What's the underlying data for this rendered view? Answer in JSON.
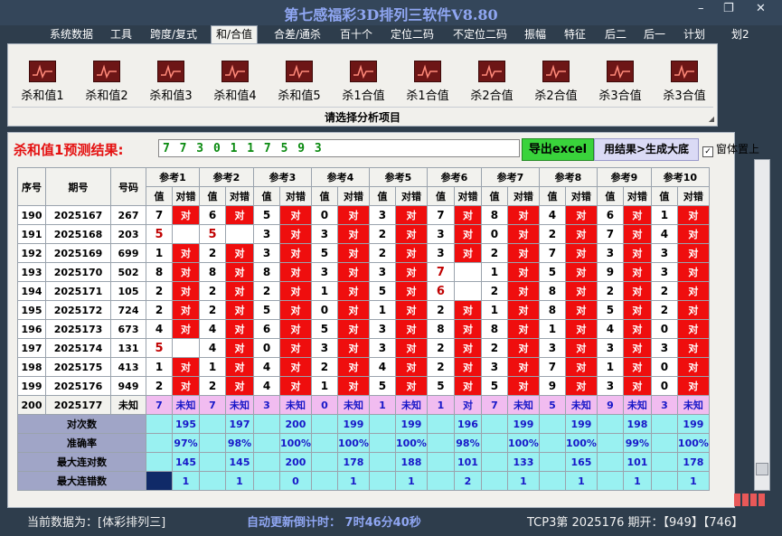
{
  "app": {
    "title": "第七感福彩3D排列三软件V8.80"
  },
  "menu": [
    "系统数据",
    "工具",
    "跨度/复式",
    "和/合值",
    "合差/通杀",
    "百十个",
    "定位二码",
    "不定位二码",
    "振幅",
    "特征",
    "后二",
    "后一",
    "计划",
    "划2"
  ],
  "menu_active_index": 3,
  "ribbon": {
    "buttons": [
      "杀和值1",
      "杀和值2",
      "杀和值3",
      "杀和值4",
      "杀和值5",
      "杀1合值",
      "杀1合值",
      "杀2合值",
      "杀2合值",
      "杀3合值",
      "杀3合值"
    ],
    "icon_name": "chart-icon",
    "caption": "请选择分析项目"
  },
  "prediction": {
    "label": "杀和值1预测结果:",
    "value": "7 7 3 0 1 1 7 5 9 3",
    "export_button": "导出excel",
    "result_button": "用结果>生成大底",
    "topmost_label": "窗体置上",
    "topmost_checked": true
  },
  "table": {
    "headers": [
      "序号",
      "期号",
      "号码"
    ],
    "refs": [
      "参考1",
      "参考2",
      "参考3",
      "参考4",
      "参考5",
      "参考6",
      "参考7",
      "参考8",
      "参考9",
      "参考10"
    ],
    "sub_headers": [
      "值",
      "对错"
    ],
    "hit_text": "对",
    "rows": [
      {
        "idx": "190",
        "period": "2025167",
        "code": "267",
        "vals": [
          "7",
          "6",
          "5",
          "0",
          "3",
          "7",
          "8",
          "4",
          "6",
          "1"
        ],
        "hits": [
          1,
          1,
          1,
          1,
          1,
          1,
          1,
          1,
          1,
          1
        ]
      },
      {
        "idx": "191",
        "period": "2025168",
        "code": "203",
        "vals": [
          "5",
          "5",
          "3",
          "3",
          "2",
          "3",
          "0",
          "2",
          "7",
          "4"
        ],
        "hits": [
          0,
          0,
          1,
          1,
          1,
          1,
          1,
          1,
          1,
          1
        ]
      },
      {
        "idx": "192",
        "period": "2025169",
        "code": "699",
        "vals": [
          "1",
          "2",
          "3",
          "5",
          "2",
          "3",
          "2",
          "7",
          "3",
          "3"
        ],
        "hits": [
          1,
          1,
          1,
          1,
          1,
          1,
          1,
          1,
          1,
          1
        ]
      },
      {
        "idx": "193",
        "period": "2025170",
        "code": "502",
        "vals": [
          "8",
          "8",
          "8",
          "3",
          "3",
          "7",
          "1",
          "5",
          "9",
          "3"
        ],
        "hits": [
          1,
          1,
          1,
          1,
          1,
          0,
          1,
          1,
          1,
          1
        ]
      },
      {
        "idx": "194",
        "period": "2025171",
        "code": "105",
        "vals": [
          "2",
          "2",
          "2",
          "1",
          "5",
          "6",
          "2",
          "8",
          "2",
          "2"
        ],
        "hits": [
          1,
          1,
          1,
          1,
          1,
          0,
          1,
          1,
          1,
          1
        ]
      },
      {
        "idx": "195",
        "period": "2025172",
        "code": "724",
        "vals": [
          "2",
          "2",
          "5",
          "0",
          "1",
          "2",
          "1",
          "8",
          "5",
          "2"
        ],
        "hits": [
          1,
          1,
          1,
          1,
          1,
          1,
          1,
          1,
          1,
          1
        ]
      },
      {
        "idx": "196",
        "period": "2025173",
        "code": "673",
        "vals": [
          "4",
          "4",
          "6",
          "5",
          "3",
          "8",
          "8",
          "1",
          "4",
          "0"
        ],
        "hits": [
          1,
          1,
          1,
          1,
          1,
          1,
          1,
          1,
          1,
          1
        ]
      },
      {
        "idx": "197",
        "period": "2025174",
        "code": "131",
        "vals": [
          "5",
          "4",
          "0",
          "3",
          "3",
          "2",
          "2",
          "3",
          "3",
          "3"
        ],
        "hits": [
          0,
          1,
          1,
          1,
          1,
          1,
          1,
          1,
          1,
          1
        ]
      },
      {
        "idx": "198",
        "period": "2025175",
        "code": "413",
        "vals": [
          "1",
          "1",
          "4",
          "2",
          "4",
          "2",
          "3",
          "7",
          "1",
          "0"
        ],
        "hits": [
          1,
          1,
          1,
          1,
          1,
          1,
          1,
          1,
          1,
          1
        ]
      },
      {
        "idx": "199",
        "period": "2025176",
        "code": "949",
        "vals": [
          "2",
          "2",
          "4",
          "1",
          "5",
          "5",
          "5",
          "9",
          "3",
          "0"
        ],
        "hits": [
          1,
          1,
          1,
          1,
          1,
          1,
          1,
          1,
          1,
          1
        ]
      }
    ],
    "pending": {
      "idx": "200",
      "period": "2025177",
      "code": "未知",
      "vals": [
        "7",
        "7",
        "3",
        "0",
        "1",
        "1",
        "7",
        "5",
        "9",
        "3"
      ],
      "unknown_text": "未知"
    },
    "pending_ref6_result": "对",
    "stats": [
      {
        "label": "对次数",
        "values": [
          "195",
          "197",
          "200",
          "199",
          "199",
          "196",
          "199",
          "199",
          "198",
          "199"
        ]
      },
      {
        "label": "准确率",
        "values": [
          "97%",
          "98%",
          "100%",
          "100%",
          "100%",
          "98%",
          "100%",
          "100%",
          "99%",
          "100%"
        ]
      },
      {
        "label": "最大连对数",
        "values": [
          "145",
          "145",
          "200",
          "178",
          "188",
          "101",
          "133",
          "165",
          "101",
          "178"
        ]
      },
      {
        "label": "最大连错数",
        "values": [
          "1",
          "1",
          "0",
          "1",
          "1",
          "2",
          "1",
          "1",
          "1",
          "1"
        ]
      }
    ]
  },
  "status_bar": {
    "data_label": "当前数据为：[体彩排列三]",
    "countdown": "自动更新倒计时：  7时46分40秒",
    "info": "TCP3第  2025176  期开：【949】【746】"
  },
  "colors": {
    "hit": "#ef0e0e",
    "pending": "#f1bcf0",
    "stat": "#99f1f1",
    "stat_label": "#a0a5c7",
    "accent": "#8fa6f2"
  }
}
